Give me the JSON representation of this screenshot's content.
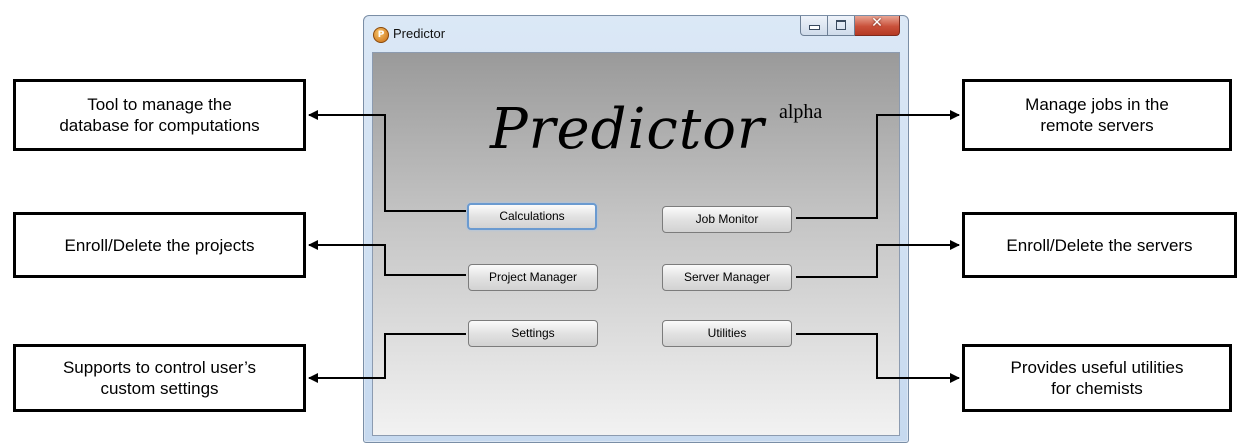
{
  "window": {
    "title": "Predictor",
    "app_icon": "predictor-app-icon"
  },
  "logo": {
    "text": "Predictor",
    "superscript": "alpha"
  },
  "buttons": {
    "calculations": "Calculations",
    "job_monitor": "Job Monitor",
    "project_manager": "Project Manager",
    "server_manager": "Server Manager",
    "settings": "Settings",
    "utilities": "Utilities"
  },
  "callouts": {
    "calculations_line1": "Tool to manage the",
    "calculations_line2": "database for computations",
    "project_manager": "Enroll/Delete the projects",
    "settings_line1": "Supports to control user’s",
    "settings_line2": "custom settings",
    "job_monitor_line1": "Manage jobs in the",
    "job_monitor_line2": "remote servers",
    "server_manager": "Enroll/Delete the servers",
    "utilities_line1": "Provides useful utilities",
    "utilities_line2": "for chemists"
  },
  "colors": {
    "focus_border": "#6a9ad0",
    "close_button": "#c9503a"
  }
}
